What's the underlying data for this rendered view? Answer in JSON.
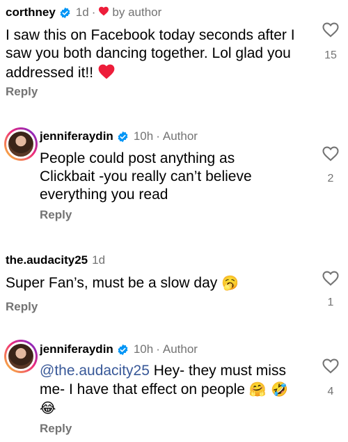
{
  "comments": [
    {
      "username": "corthney",
      "time": "1d",
      "badge": "by author",
      "text": "I saw this on Facebook today seconds after I saw you both dancing together. Lol glad you addressed it!!",
      "emoji": "heart",
      "reply": "Reply",
      "likes": "15"
    },
    {
      "username": "jenniferaydin",
      "time": "10h",
      "badge": "Author",
      "text": "People could post anything as Clickbait -you really can’t believe everything you read",
      "reply": "Reply",
      "likes": "2"
    },
    {
      "username": "the.audacity25",
      "time": "1d",
      "text": "Super Fan’s, must be a slow day",
      "emoji": "🥱",
      "reply": "Reply",
      "likes": "1"
    },
    {
      "username": "jenniferaydin",
      "time": "10h",
      "badge": "Author",
      "mention": "@the.audacity25",
      "text": "Hey- they must miss me- I have that effect on people",
      "emoji": "🤗 🤣 😂",
      "reply": "Reply",
      "likes": "4"
    }
  ],
  "colors": {
    "verified": "#0095f6",
    "heart": "#ed1d3a",
    "muted": "#737373",
    "mention": "#385898"
  },
  "icons": [
    "verified-badge-icon",
    "heart-icon",
    "like-heart-outline-icon"
  ]
}
